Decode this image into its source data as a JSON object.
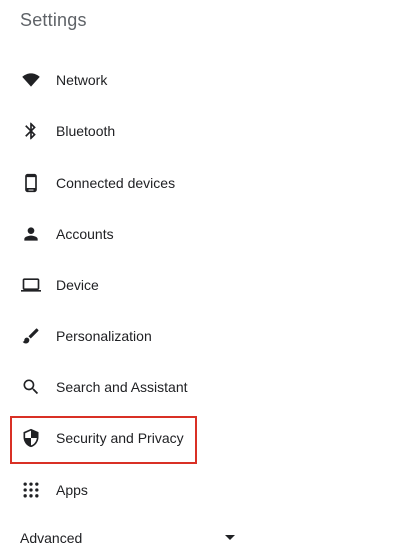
{
  "header": {
    "title": "Settings"
  },
  "nav": {
    "items": [
      {
        "label": "Network",
        "icon": "wifi-icon"
      },
      {
        "label": "Bluetooth",
        "icon": "bluetooth-icon"
      },
      {
        "label": "Connected devices",
        "icon": "phone-icon"
      },
      {
        "label": "Accounts",
        "icon": "person-icon"
      },
      {
        "label": "Device",
        "icon": "laptop-icon"
      },
      {
        "label": "Personalization",
        "icon": "brush-icon"
      },
      {
        "label": "Search and Assistant",
        "icon": "search-icon"
      },
      {
        "label": "Security and Privacy",
        "icon": "shield-icon",
        "highlighted": true
      },
      {
        "label": "Apps",
        "icon": "apps-grid-icon"
      }
    ]
  },
  "advanced": {
    "label": "Advanced",
    "icon": "caret-down-icon"
  },
  "colors": {
    "text": "#202124",
    "title": "#5f6368",
    "highlight": "#d93025",
    "background": "#ffffff"
  }
}
